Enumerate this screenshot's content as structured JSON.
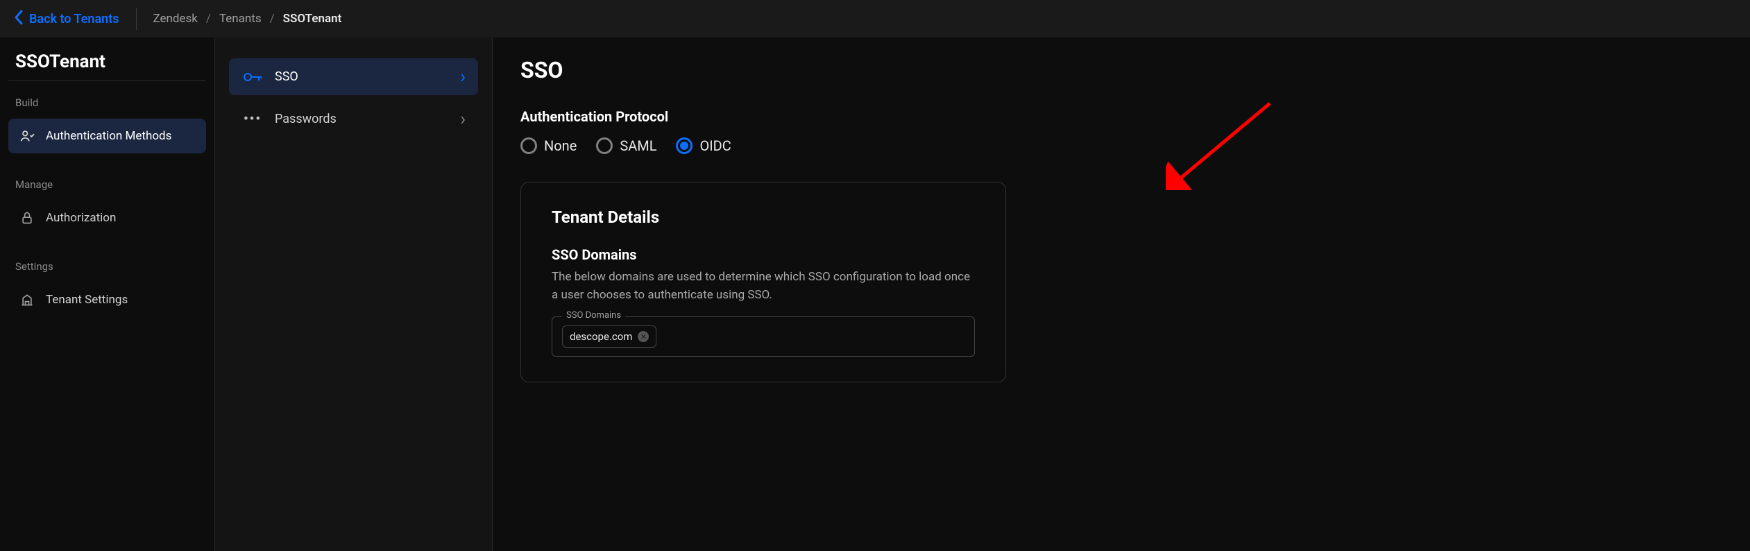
{
  "header": {
    "back_label": "Back to Tenants",
    "breadcrumbs": [
      "Zendesk",
      "Tenants",
      "SSOTenant"
    ]
  },
  "sidebar": {
    "title": "SSOTenant",
    "sections": [
      {
        "label": "Build",
        "items": [
          {
            "label": "Authentication Methods",
            "key": "auth-methods",
            "active": true
          }
        ]
      },
      {
        "label": "Manage",
        "items": [
          {
            "label": "Authorization",
            "key": "authorization",
            "active": false
          }
        ]
      },
      {
        "label": "Settings",
        "items": [
          {
            "label": "Tenant Settings",
            "key": "tenant-settings",
            "active": false
          }
        ]
      }
    ]
  },
  "submenu": {
    "items": [
      {
        "label": "SSO",
        "key": "sso",
        "active": true
      },
      {
        "label": "Passwords",
        "key": "passwords",
        "active": false
      }
    ]
  },
  "content": {
    "title": "SSO",
    "auth_protocol": {
      "label": "Authentication Protocol",
      "options": [
        {
          "label": "None",
          "value": "none",
          "selected": false
        },
        {
          "label": "SAML",
          "value": "saml",
          "selected": false
        },
        {
          "label": "OIDC",
          "value": "oidc",
          "selected": true
        }
      ]
    },
    "tenant_details": {
      "title": "Tenant Details",
      "sso_domains": {
        "title": "SSO Domains",
        "description": "The below domains are used to determine which SSO configuration to load once a user chooses to authenticate using SSO.",
        "legend": "SSO Domains",
        "chips": [
          "descope.com"
        ]
      }
    }
  },
  "colors": {
    "accent": "#0d6efd"
  }
}
